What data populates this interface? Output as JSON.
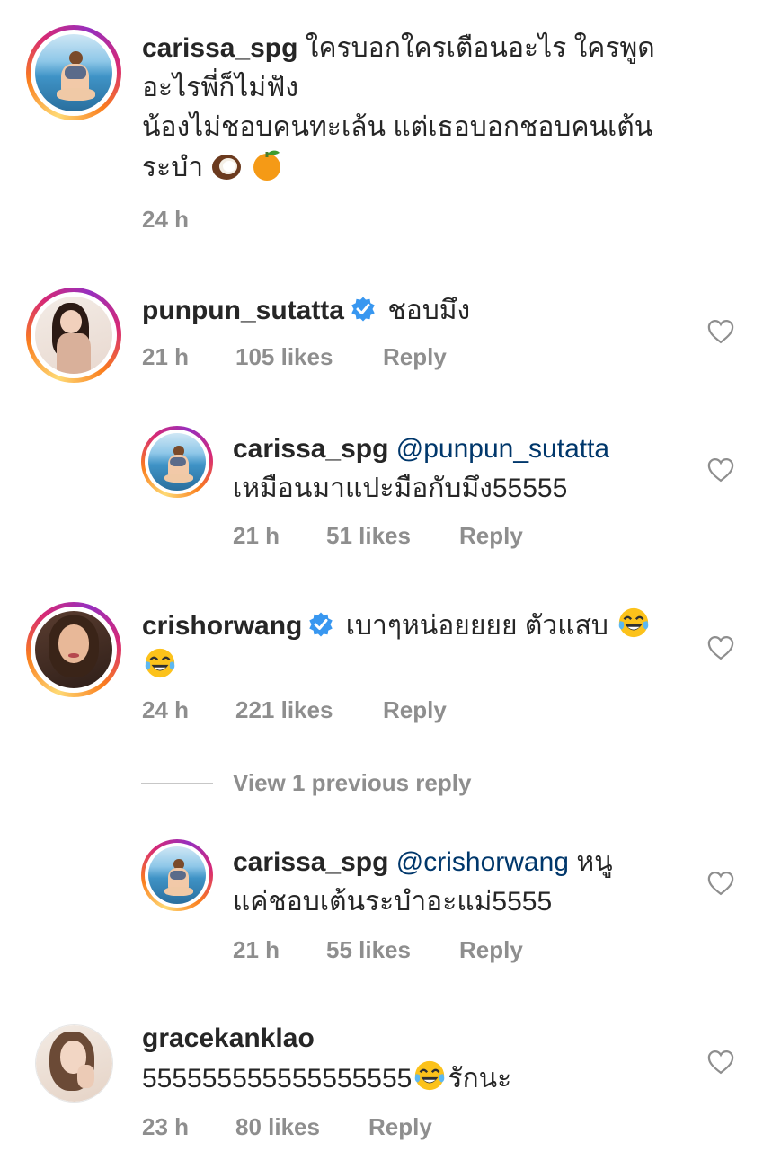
{
  "caption": {
    "username": "carissa_spg",
    "text_line1": "ใครบอกใครเตือนอะไร ใครพูด",
    "text_line2": "อะไรพี่ก็ไม่ฟัง",
    "text_line3": "น้องไม่ชอบคนทะเล้น แต่เธอบอกชอบคนเต้น",
    "text_line4": "ระบำ",
    "emojis": [
      "coconut-emoji",
      "tangerine-emoji"
    ],
    "time": "24 h"
  },
  "comments": [
    {
      "username": "punpun_sutatta",
      "verified": true,
      "text": "ชอบมึง",
      "time": "21 h",
      "likes": "105 likes",
      "reply_label": "Reply",
      "replies": [
        {
          "username": "carissa_spg",
          "mention": "@punpun_sutatta",
          "text": "เหมือนมาแปะมือกับมึง55555",
          "time": "21 h",
          "likes": "51 likes",
          "reply_label": "Reply"
        }
      ]
    },
    {
      "username": "crishorwang",
      "verified": true,
      "text": "เบาๆหน่อยยยย ตัวแสบ",
      "time": "24 h",
      "likes": "221 likes",
      "reply_label": "Reply",
      "view_previous": "View 1 previous reply",
      "replies": [
        {
          "username": "carissa_spg",
          "mention": "@crishorwang",
          "text_inline": "หนู",
          "text_line2": "แค่ชอบเต้นระบำอะแม่5555",
          "time": "21 h",
          "likes": "55 likes",
          "reply_label": "Reply"
        }
      ]
    },
    {
      "username": "gracekanklao",
      "verified": false,
      "text_before": "555555555555555555",
      "text_after": "รักนะ",
      "time": "23 h",
      "likes": "80 likes",
      "reply_label": "Reply"
    }
  ],
  "colors": {
    "text": "#262626",
    "meta": "#8e8e8e",
    "mention": "#00376b",
    "verified": "#3897f0",
    "divider": "#dbdbdb"
  }
}
